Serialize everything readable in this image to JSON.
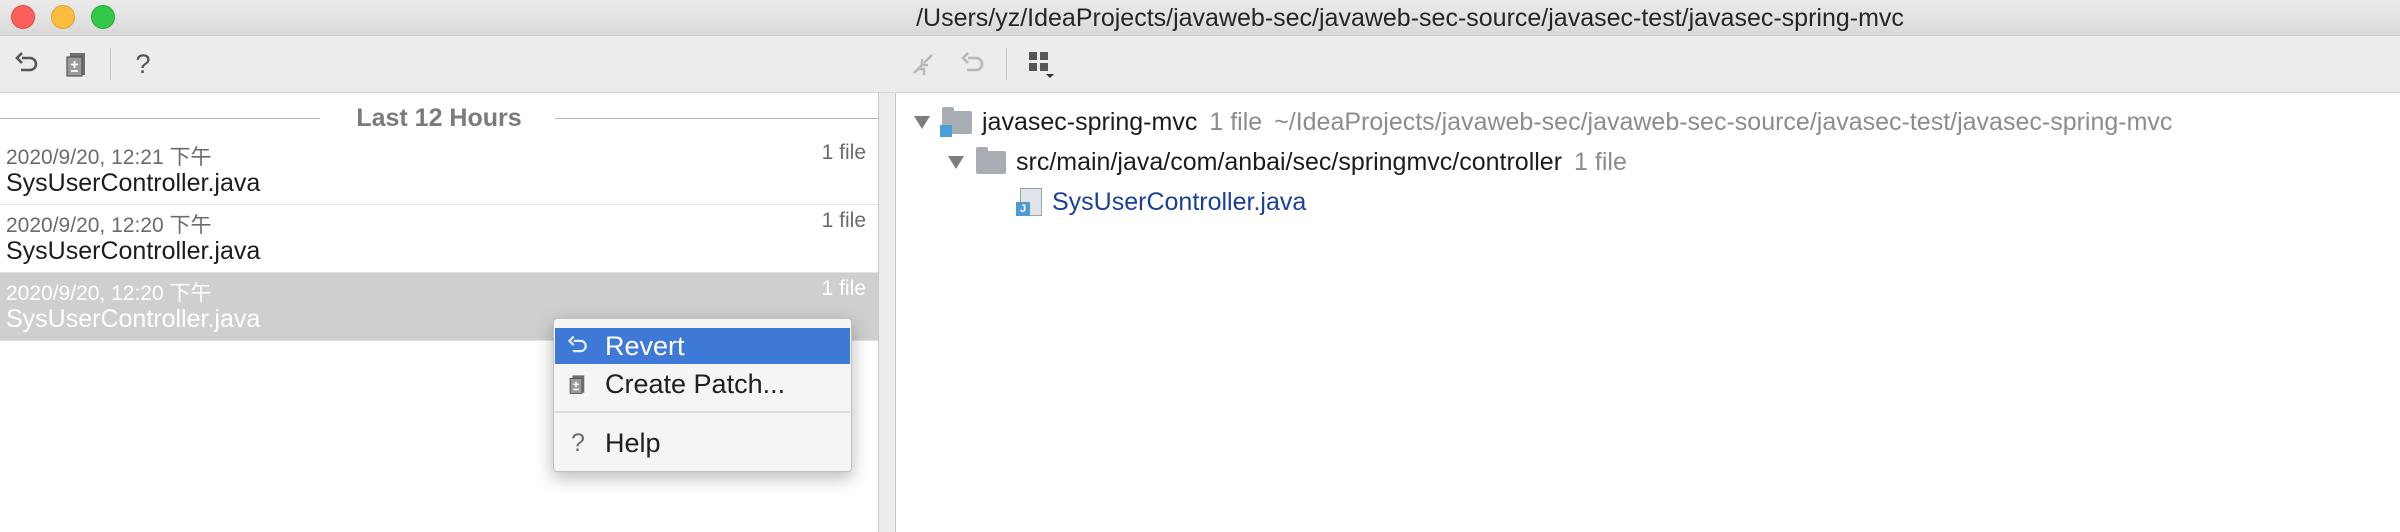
{
  "window": {
    "title": "/Users/yz/IdeaProjects/javaweb-sec/javaweb-sec-source/javasec-test/javasec-spring-mvc"
  },
  "toolbar": {
    "left_icons": [
      "revert-icon",
      "create-patch-icon",
      "help-icon"
    ],
    "right_icons": [
      "get-icon",
      "revert-icon",
      "group-by-icon"
    ],
    "help_glyph": "?"
  },
  "history": {
    "group_label": "Last 12 Hours",
    "rows": [
      {
        "date": "2020/9/20, 12:21 下午",
        "count": "1 file",
        "file": "SysUserController.java",
        "selected": false
      },
      {
        "date": "2020/9/20, 12:20 下午",
        "count": "1 file",
        "file": "SysUserController.java",
        "selected": false
      },
      {
        "date": "2020/9/20, 12:20 下午",
        "count": "1 file",
        "file": "SysUserController.java",
        "selected": true
      }
    ]
  },
  "context_menu": {
    "items": [
      {
        "label": "Revert",
        "icon": "revert-icon",
        "highlighted": true
      },
      {
        "label": "Create Patch...",
        "icon": "create-patch-icon",
        "highlighted": false
      },
      {
        "label": "Help",
        "icon": "help-icon",
        "highlighted": false
      }
    ],
    "help_glyph": "?"
  },
  "tree": {
    "root": {
      "name": "javasec-spring-mvc",
      "count": "1 file",
      "path": "~/IdeaProjects/javaweb-sec/javaweb-sec-source/javasec-test/javasec-spring-mvc"
    },
    "package": {
      "name": "src/main/java/com/anbai/sec/springmvc/controller",
      "count": "1 file"
    },
    "file": {
      "name": "SysUserController.java",
      "color": "#1a3f9b"
    }
  },
  "colors": {
    "selection": "#cfcfcf",
    "menu_highlight": "#3f79d8",
    "modified_file": "#1a3f9b"
  }
}
